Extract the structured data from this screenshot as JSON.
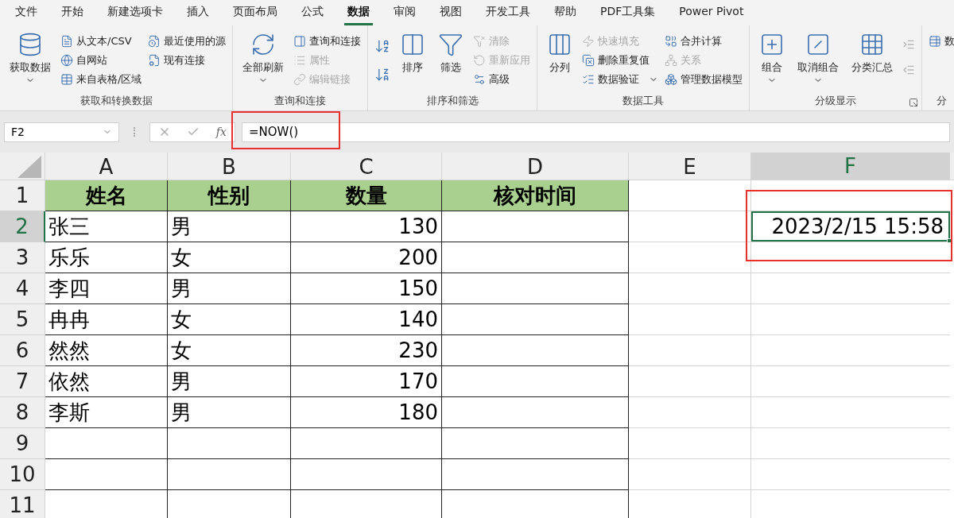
{
  "tabs": [
    {
      "label": "文件",
      "selected": false
    },
    {
      "label": "开始",
      "selected": false
    },
    {
      "label": "新建选项卡",
      "selected": false
    },
    {
      "label": "插入",
      "selected": false
    },
    {
      "label": "页面布局",
      "selected": false
    },
    {
      "label": "公式",
      "selected": false
    },
    {
      "label": "数据",
      "selected": true
    },
    {
      "label": "审阅",
      "selected": false
    },
    {
      "label": "视图",
      "selected": false
    },
    {
      "label": "开发工具",
      "selected": false
    },
    {
      "label": "帮助",
      "selected": false
    },
    {
      "label": "PDF工具集",
      "selected": false
    },
    {
      "label": "Power Pivot",
      "selected": false
    }
  ],
  "ribbon": {
    "groups": [
      {
        "label": "获取和转换数据",
        "columns": [
          {
            "kind": "large",
            "items": [
              {
                "label": "获取数据",
                "disabled": false,
                "dropdown": true
              }
            ]
          },
          {
            "kind": "stack",
            "items": [
              {
                "label": "从文本/CSV",
                "disabled": false,
                "dropdown": false
              },
              {
                "label": "自网站",
                "disabled": false,
                "dropdown": false
              },
              {
                "label": "来自表格/区域",
                "disabled": false,
                "dropdown": false
              }
            ]
          },
          {
            "kind": "stack",
            "items": [
              {
                "label": "最近使用的源",
                "disabled": false,
                "dropdown": false
              },
              {
                "label": "现有连接",
                "disabled": false,
                "dropdown": false
              }
            ]
          }
        ]
      },
      {
        "label": "查询和连接",
        "columns": [
          {
            "kind": "large",
            "items": [
              {
                "label": "全部刷新",
                "disabled": false,
                "dropdown": true
              }
            ]
          },
          {
            "kind": "stack",
            "items": [
              {
                "label": "查询和连接",
                "disabled": false,
                "dropdown": false
              },
              {
                "label": "属性",
                "disabled": true,
                "dropdown": false
              },
              {
                "label": "编辑链接",
                "disabled": true,
                "dropdown": false
              }
            ]
          }
        ]
      },
      {
        "label": "排序和筛选",
        "columns": [
          {
            "kind": "sort-icons"
          },
          {
            "kind": "large",
            "items": [
              {
                "label": "排序",
                "disabled": false,
                "dropdown": false
              }
            ]
          },
          {
            "kind": "large",
            "items": [
              {
                "label": "筛选",
                "disabled": false,
                "dropdown": false
              }
            ]
          },
          {
            "kind": "stack",
            "items": [
              {
                "label": "清除",
                "disabled": true,
                "dropdown": false
              },
              {
                "label": "重新应用",
                "disabled": true,
                "dropdown": false
              },
              {
                "label": "高级",
                "disabled": false,
                "dropdown": false
              }
            ]
          }
        ]
      },
      {
        "label": "数据工具",
        "columns": [
          {
            "kind": "large",
            "items": [
              {
                "label": "分列",
                "disabled": false,
                "dropdown": false
              }
            ]
          },
          {
            "kind": "stack",
            "items": [
              {
                "label": "快速填充",
                "disabled": true,
                "dropdown": false
              },
              {
                "label": "删除重复值",
                "disabled": false,
                "dropdown": false
              },
              {
                "label": "数据验证",
                "disabled": false,
                "dropdown": true
              }
            ]
          },
          {
            "kind": "stack",
            "items": [
              {
                "label": "合并计算",
                "disabled": false,
                "dropdown": false
              },
              {
                "label": "关系",
                "disabled": true,
                "dropdown": false
              },
              {
                "label": "管理数据模型",
                "disabled": false,
                "dropdown": false
              }
            ]
          }
        ]
      },
      {
        "label": "分级显示",
        "launcher": true,
        "columns": [
          {
            "kind": "large",
            "items": [
              {
                "label": "组合",
                "disabled": false,
                "dropdown": true
              }
            ]
          },
          {
            "kind": "large",
            "items": [
              {
                "label": "取消组合",
                "disabled": false,
                "dropdown": true
              }
            ]
          },
          {
            "kind": "large",
            "items": [
              {
                "label": "分类汇总",
                "disabled": false,
                "dropdown": false
              }
            ]
          },
          {
            "kind": "outline-icons"
          }
        ]
      },
      {
        "label": "分",
        "columns": [
          {
            "kind": "stack",
            "items": [
              {
                "label": "数",
                "disabled": false,
                "dropdown": false
              }
            ]
          }
        ]
      }
    ]
  },
  "formula_bar": {
    "name_box": "F2",
    "function_label": "fx",
    "formula": "=NOW()",
    "highlighted": true
  },
  "sheet": {
    "columns": [
      {
        "label": "A",
        "selected": false
      },
      {
        "label": "B",
        "selected": false
      },
      {
        "label": "C",
        "selected": false
      },
      {
        "label": "D",
        "selected": false
      },
      {
        "label": "E",
        "selected": false
      },
      {
        "label": "F",
        "selected": true
      }
    ],
    "rows": [
      {
        "label": "1",
        "selected": false,
        "kind": "header",
        "cells": [
          "姓名",
          "性别",
          "数量",
          "核对时间"
        ]
      },
      {
        "label": "2",
        "selected": true,
        "kind": "data",
        "cells": [
          "张三",
          "男",
          "130"
        ],
        "f_cell": {
          "value": "2023/2/15 15:58",
          "selected": true,
          "highlighted": true
        }
      },
      {
        "label": "3",
        "selected": false,
        "kind": "data",
        "cells": [
          "乐乐",
          "女",
          "200"
        ]
      },
      {
        "label": "4",
        "selected": false,
        "kind": "data",
        "cells": [
          "李四",
          "男",
          "150"
        ]
      },
      {
        "label": "5",
        "selected": false,
        "kind": "data",
        "cells": [
          "冉冉",
          "女",
          "140"
        ]
      },
      {
        "label": "6",
        "selected": false,
        "kind": "data",
        "cells": [
          "然然",
          "女",
          "230"
        ]
      },
      {
        "label": "7",
        "selected": false,
        "kind": "data",
        "cells": [
          "依然",
          "男",
          "170"
        ]
      },
      {
        "label": "8",
        "selected": false,
        "kind": "data",
        "cells": [
          "李斯",
          "男",
          "180"
        ]
      },
      {
        "label": "9",
        "selected": false,
        "kind": "data",
        "cells": []
      },
      {
        "label": "10",
        "selected": false,
        "kind": "data",
        "cells": []
      },
      {
        "label": "11",
        "selected": false,
        "kind": "data",
        "cells": []
      }
    ]
  }
}
